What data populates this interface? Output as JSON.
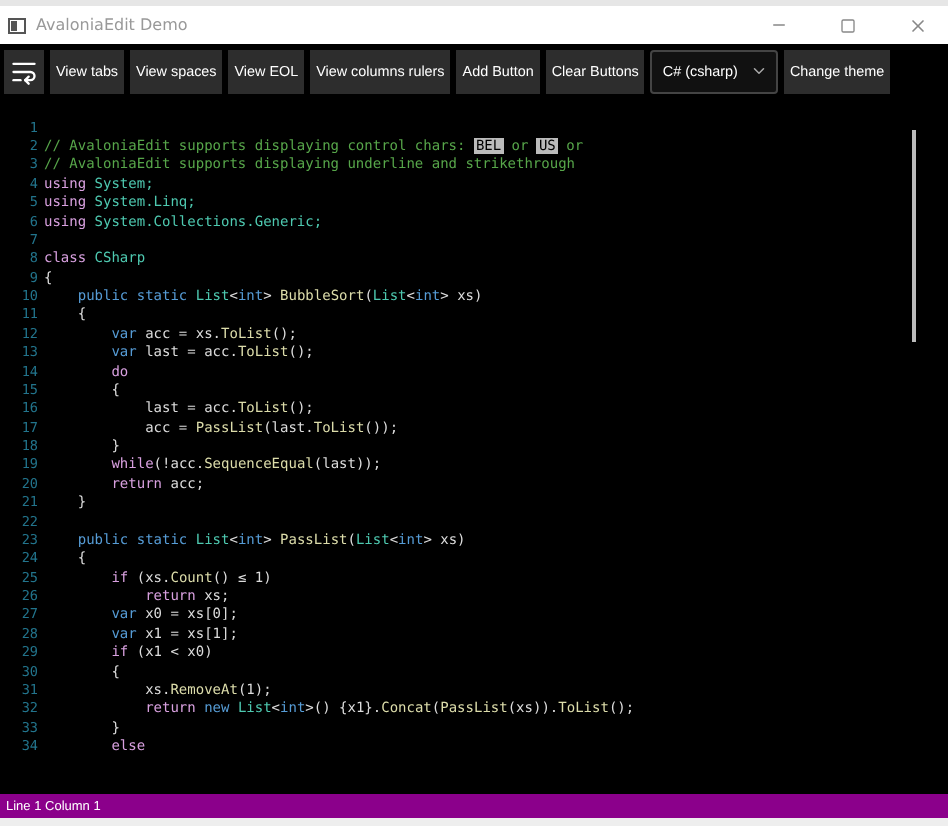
{
  "window": {
    "title": "AvaloniaEdit Demo"
  },
  "toolbar": {
    "buttons": [
      "View tabs",
      "View spaces",
      "View EOL",
      "View columns rulers",
      "Add Button",
      "Clear Buttons"
    ],
    "language": "C# (csharp)",
    "theme_button": "Change theme"
  },
  "editor": {
    "lines": [
      {
        "number": "1"
      },
      {
        "number": "2",
        "tokens": [
          {
            "text": "// AvaloniaEdit supports displaying control chars: ",
            "kind": "comment"
          },
          {
            "text": "BEL",
            "kind": "control"
          },
          {
            "text": " or ",
            "kind": "comment"
          },
          {
            "text": "US",
            "kind": "control"
          },
          {
            "text": " or",
            "kind": "comment"
          }
        ]
      },
      {
        "number": "3",
        "tokens": [
          {
            "text": "// AvaloniaEdit supports displaying underline and strikethrough",
            "kind": "comment"
          }
        ]
      },
      {
        "number": "4",
        "tokens": [
          {
            "text": "using",
            "kind": "flow"
          },
          {
            "text": " System;",
            "kind": "type"
          }
        ]
      },
      {
        "number": "5",
        "tokens": [
          {
            "text": "using",
            "kind": "flow"
          },
          {
            "text": " System.Linq;",
            "kind": "type"
          }
        ]
      },
      {
        "number": "6",
        "tokens": [
          {
            "text": "using",
            "kind": "flow"
          },
          {
            "text": " System.Collections.Generic;",
            "kind": "type"
          }
        ]
      },
      {
        "number": "7"
      },
      {
        "number": "8",
        "tokens": [
          {
            "text": "class",
            "kind": "flow"
          },
          {
            "text": " CSharp",
            "kind": "type"
          }
        ]
      },
      {
        "number": "9",
        "tokens": [
          {
            "text": "{",
            "kind": "plain"
          }
        ]
      },
      {
        "number": "10",
        "tokens": [
          {
            "text": "    public static ",
            "kind": "keyword"
          },
          {
            "text": "List",
            "kind": "type"
          },
          {
            "text": "<",
            "kind": "plain"
          },
          {
            "text": "int",
            "kind": "keyword"
          },
          {
            "text": "> ",
            "kind": "plain"
          },
          {
            "text": "BubbleSort",
            "kind": "method"
          },
          {
            "text": "(",
            "kind": "plain"
          },
          {
            "text": "List",
            "kind": "type"
          },
          {
            "text": "<",
            "kind": "plain"
          },
          {
            "text": "int",
            "kind": "keyword"
          },
          {
            "text": "> xs)",
            "kind": "plain"
          }
        ]
      },
      {
        "number": "11",
        "tokens": [
          {
            "text": "    {",
            "kind": "plain"
          }
        ]
      },
      {
        "number": "12",
        "tokens": [
          {
            "text": "        var",
            "kind": "keyword"
          },
          {
            "text": " acc = xs.",
            "kind": "plain"
          },
          {
            "text": "ToList",
            "kind": "method"
          },
          {
            "text": "();",
            "kind": "plain"
          }
        ]
      },
      {
        "number": "13",
        "tokens": [
          {
            "text": "        var",
            "kind": "keyword"
          },
          {
            "text": " last = acc.",
            "kind": "plain"
          },
          {
            "text": "ToList",
            "kind": "method"
          },
          {
            "text": "();",
            "kind": "plain"
          }
        ]
      },
      {
        "number": "14",
        "tokens": [
          {
            "text": "        do",
            "kind": "flow"
          }
        ]
      },
      {
        "number": "15",
        "tokens": [
          {
            "text": "        {",
            "kind": "plain"
          }
        ]
      },
      {
        "number": "16",
        "tokens": [
          {
            "text": "            last = acc.",
            "kind": "plain"
          },
          {
            "text": "ToList",
            "kind": "method"
          },
          {
            "text": "();",
            "kind": "plain"
          }
        ]
      },
      {
        "number": "17",
        "tokens": [
          {
            "text": "            acc = ",
            "kind": "plain"
          },
          {
            "text": "PassList",
            "kind": "method"
          },
          {
            "text": "(last.",
            "kind": "plain"
          },
          {
            "text": "ToList",
            "kind": "method"
          },
          {
            "text": "());",
            "kind": "plain"
          }
        ]
      },
      {
        "number": "18",
        "tokens": [
          {
            "text": "        }",
            "kind": "plain"
          }
        ]
      },
      {
        "number": "19",
        "tokens": [
          {
            "text": "        while",
            "kind": "flow"
          },
          {
            "text": "(!acc.",
            "kind": "plain"
          },
          {
            "text": "SequenceEqual",
            "kind": "method"
          },
          {
            "text": "(last));",
            "kind": "plain"
          }
        ]
      },
      {
        "number": "20",
        "tokens": [
          {
            "text": "        return",
            "kind": "flow"
          },
          {
            "text": " acc;",
            "kind": "plain"
          }
        ]
      },
      {
        "number": "21",
        "tokens": [
          {
            "text": "    }",
            "kind": "plain"
          }
        ]
      },
      {
        "number": "22"
      },
      {
        "number": "23",
        "tokens": [
          {
            "text": "    public static ",
            "kind": "keyword"
          },
          {
            "text": "List",
            "kind": "type"
          },
          {
            "text": "<",
            "kind": "plain"
          },
          {
            "text": "int",
            "kind": "keyword"
          },
          {
            "text": "> ",
            "kind": "plain"
          },
          {
            "text": "PassList",
            "kind": "method"
          },
          {
            "text": "(",
            "kind": "plain"
          },
          {
            "text": "List",
            "kind": "type"
          },
          {
            "text": "<",
            "kind": "plain"
          },
          {
            "text": "int",
            "kind": "keyword"
          },
          {
            "text": "> xs)",
            "kind": "plain"
          }
        ]
      },
      {
        "number": "24",
        "tokens": [
          {
            "text": "    {",
            "kind": "plain"
          }
        ]
      },
      {
        "number": "25",
        "tokens": [
          {
            "text": "        if",
            "kind": "flow"
          },
          {
            "text": " (xs.",
            "kind": "plain"
          },
          {
            "text": "Count",
            "kind": "method"
          },
          {
            "text": "() ≤ 1)",
            "kind": "plain"
          }
        ]
      },
      {
        "number": "26",
        "tokens": [
          {
            "text": "            return",
            "kind": "flow"
          },
          {
            "text": " xs;",
            "kind": "plain"
          }
        ]
      },
      {
        "number": "27",
        "tokens": [
          {
            "text": "        var",
            "kind": "keyword"
          },
          {
            "text": " x0 = xs[0];",
            "kind": "plain"
          }
        ]
      },
      {
        "number": "28",
        "tokens": [
          {
            "text": "        var",
            "kind": "keyword"
          },
          {
            "text": " x1 = xs[1];",
            "kind": "plain"
          }
        ]
      },
      {
        "number": "29",
        "tokens": [
          {
            "text": "        if",
            "kind": "flow"
          },
          {
            "text": " (x1 < x0)",
            "kind": "plain"
          }
        ]
      },
      {
        "number": "30",
        "tokens": [
          {
            "text": "        {",
            "kind": "plain"
          }
        ]
      },
      {
        "number": "31",
        "tokens": [
          {
            "text": "            xs.",
            "kind": "plain"
          },
          {
            "text": "RemoveAt",
            "kind": "method"
          },
          {
            "text": "(1);",
            "kind": "plain"
          }
        ]
      },
      {
        "number": "32",
        "tokens": [
          {
            "text": "            return",
            "kind": "flow"
          },
          {
            "text": " new ",
            "kind": "keyword"
          },
          {
            "text": "List",
            "kind": "type"
          },
          {
            "text": "<",
            "kind": "plain"
          },
          {
            "text": "int",
            "kind": "keyword"
          },
          {
            "text": ">() {x1}.",
            "kind": "plain"
          },
          {
            "text": "Concat",
            "kind": "method"
          },
          {
            "text": "(",
            "kind": "plain"
          },
          {
            "text": "PassList",
            "kind": "method"
          },
          {
            "text": "(xs)).",
            "kind": "plain"
          },
          {
            "text": "ToList",
            "kind": "method"
          },
          {
            "text": "();",
            "kind": "plain"
          }
        ]
      },
      {
        "number": "33",
        "tokens": [
          {
            "text": "        }",
            "kind": "plain"
          }
        ]
      },
      {
        "number": "34",
        "tokens": [
          {
            "text": "        else",
            "kind": "flow"
          }
        ]
      }
    ]
  },
  "status_bar": {
    "text": "Line 1 Column 1"
  }
}
